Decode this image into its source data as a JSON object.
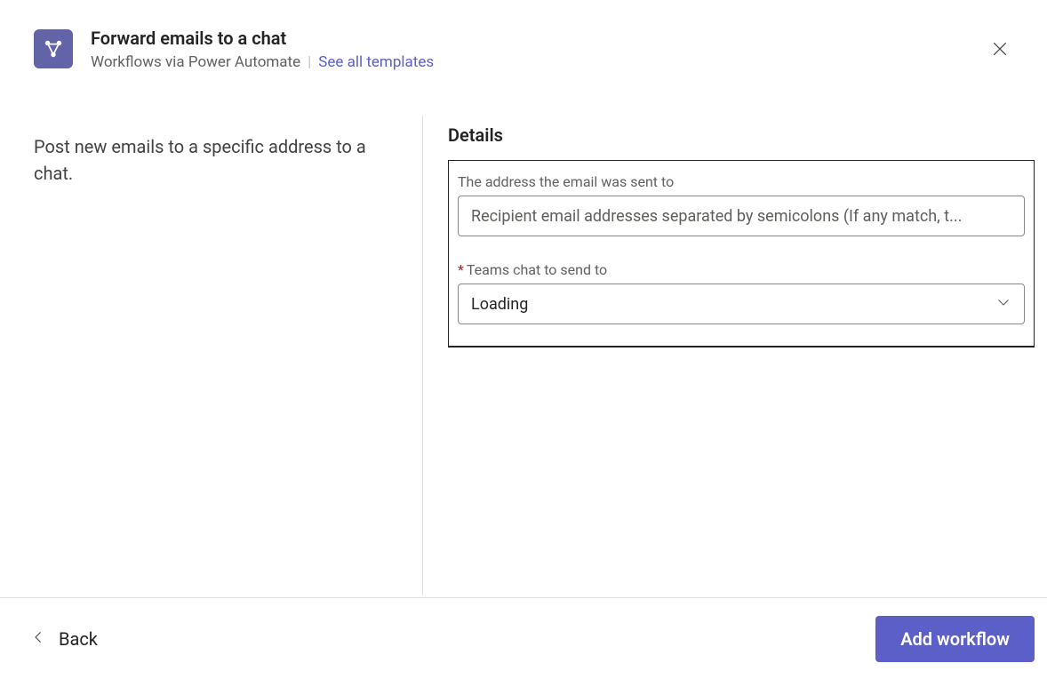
{
  "header": {
    "title": "Forward emails to a chat",
    "subtitle": "Workflows via Power Automate",
    "see_all_link": "See all templates"
  },
  "left": {
    "description": "Post new emails to a specific address to a chat."
  },
  "details": {
    "section_title": "Details",
    "fields": [
      {
        "label": "The address the email was sent to",
        "required": false,
        "placeholder": "Recipient email addresses separated by semicolons (If any match, t...",
        "value": ""
      },
      {
        "label": "Teams chat to send to",
        "required": true,
        "value": "Loading"
      }
    ]
  },
  "footer": {
    "back_label": "Back",
    "primary_label": "Add workflow"
  }
}
